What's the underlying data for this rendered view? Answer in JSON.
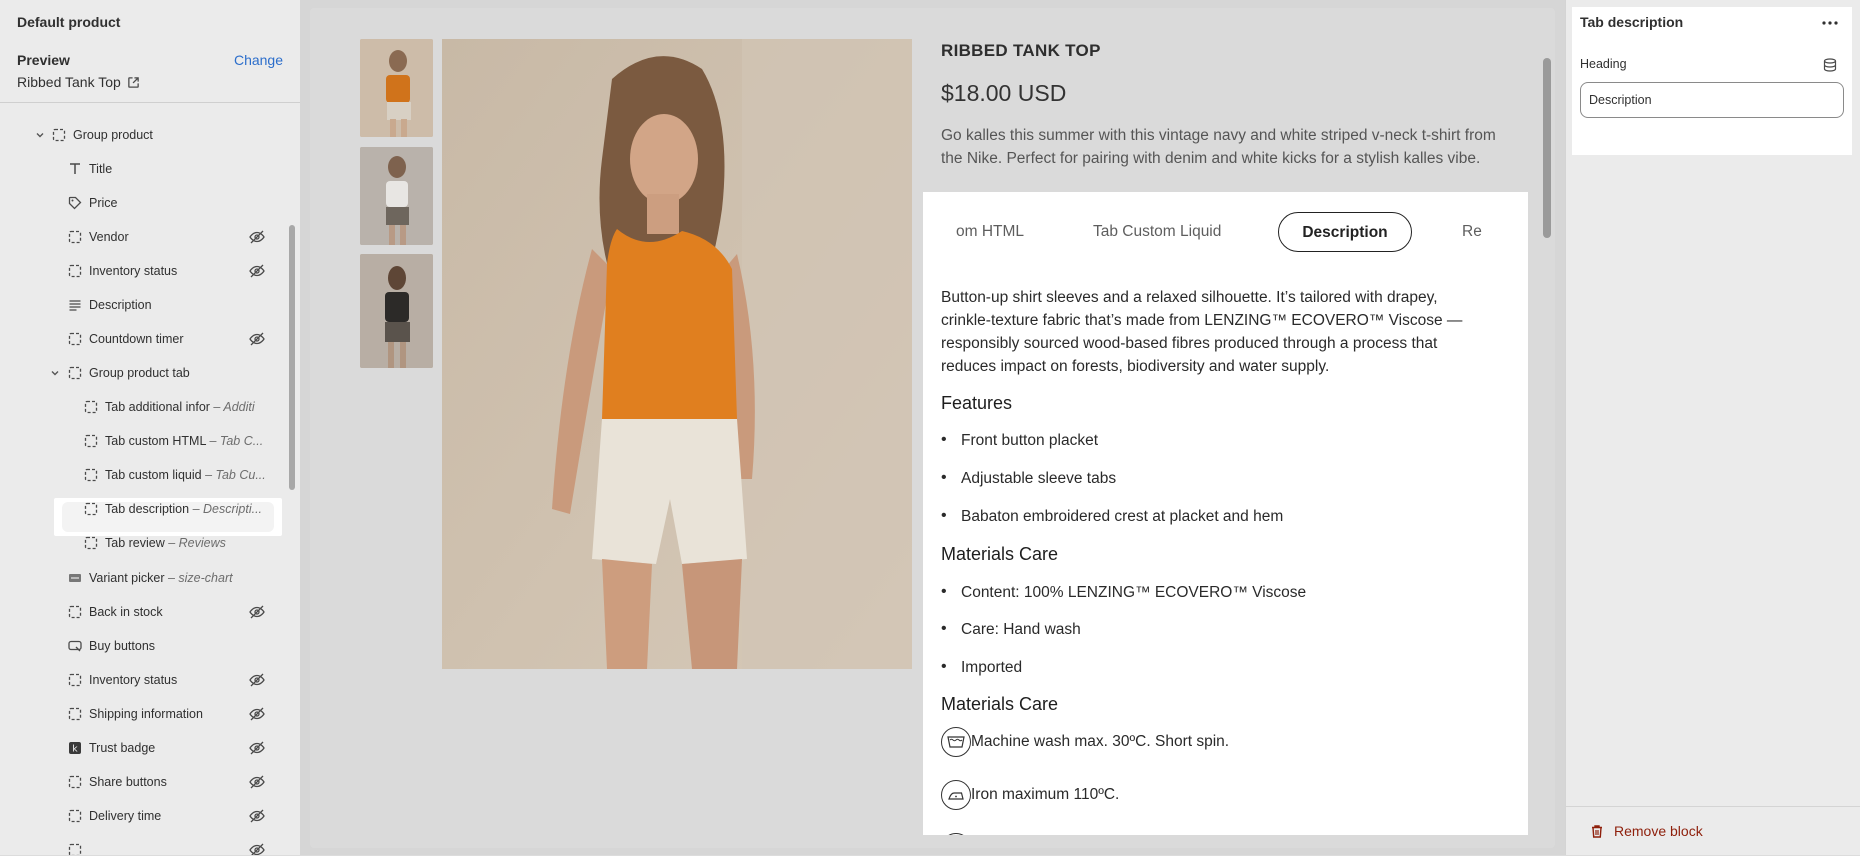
{
  "sidebar": {
    "title": "Default product",
    "preview_label": "Preview",
    "change_label": "Change",
    "product_name": "Ribbed Tank Top",
    "items": [
      {
        "label": "Group product",
        "sub": ""
      },
      {
        "label": "Title",
        "sub": ""
      },
      {
        "label": "Price",
        "sub": ""
      },
      {
        "label": "Vendor",
        "sub": ""
      },
      {
        "label": "Inventory status",
        "sub": ""
      },
      {
        "label": "Description",
        "sub": ""
      },
      {
        "label": "Countdown timer",
        "sub": ""
      },
      {
        "label": "Group product tab",
        "sub": ""
      },
      {
        "label": "Tab additional infor",
        "sub": "– Additi"
      },
      {
        "label": "Tab custom HTML",
        "sub": "– Tab C..."
      },
      {
        "label": "Tab custom liquid",
        "sub": "– Tab Cu..."
      },
      {
        "label": "Tab description",
        "sub": "– Descripti..."
      },
      {
        "label": "Tab review",
        "sub": "– Reviews"
      },
      {
        "label": "Variant picker",
        "sub": "– size-chart"
      },
      {
        "label": "Back in stock",
        "sub": ""
      },
      {
        "label": "Buy buttons",
        "sub": ""
      },
      {
        "label": "Inventory status",
        "sub": ""
      },
      {
        "label": "Shipping information",
        "sub": ""
      },
      {
        "label": "Trust badge",
        "sub": ""
      },
      {
        "label": "Share buttons",
        "sub": ""
      },
      {
        "label": "Delivery time",
        "sub": ""
      }
    ]
  },
  "product": {
    "title": "RIBBED TANK TOP",
    "price": "$18.00 USD",
    "description": "Go kalles this summer with this vintage navy and white striped v-neck t-shirt from the Nike. Perfect for pairing with denim and white kicks for a stylish kalles vibe."
  },
  "popup": {
    "tabs": [
      "om HTML",
      "Tab Custom Liquid",
      "Description",
      "Re"
    ],
    "intro": "Button-up shirt sleeves and a relaxed silhouette. It’s tailored with drapey, crinkle-texture fabric that’s made from LENZING™ ECOVERO™ Viscose — responsibly sourced wood-based fibres produced through a process that reduces impact on forests, biodiversity and water supply.",
    "features_heading": "Features",
    "features": [
      "Front button placket",
      "Adjustable sleeve tabs",
      "Babaton embroidered crest at placket and hem"
    ],
    "materials_heading": "Materials Care",
    "materials": [
      "Content: 100% LENZING™ ECOVERO™ Viscose",
      "Care: Hand wash",
      "Imported"
    ],
    "care_heading": "Materials Care",
    "care": [
      {
        "icon": "washing-basin-icon",
        "text": "Machine wash max. 30ºC. Short spin."
      },
      {
        "icon": "iron-icon",
        "text": "Iron maximum 110ºC."
      }
    ]
  },
  "settings": {
    "title": "Tab description",
    "heading_label": "Heading",
    "heading_value": "Description",
    "remove_label": "Remove block"
  },
  "colors": {
    "accent": "#2c6ecb",
    "danger": "#8e1f0b",
    "tank_orange": "#f08a1f"
  }
}
